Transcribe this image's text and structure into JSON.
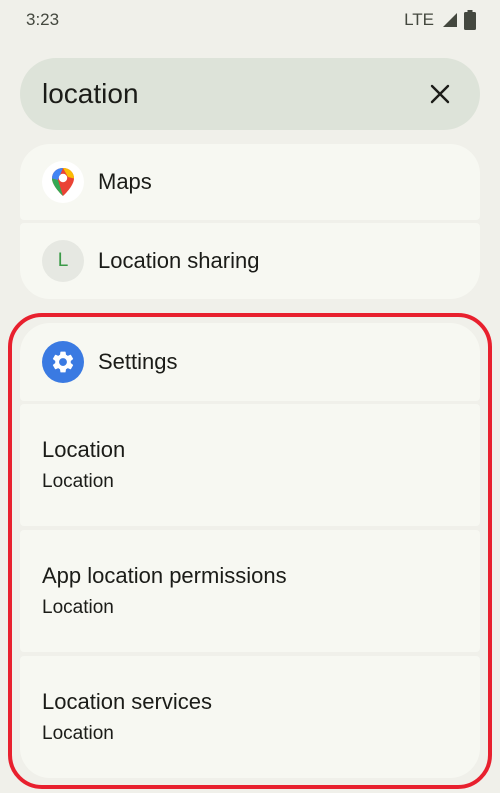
{
  "status_bar": {
    "time": "3:23",
    "network": "LTE"
  },
  "search": {
    "value": "location",
    "clear_icon": "close-icon"
  },
  "app_results": [
    {
      "name": "Maps",
      "icon": "maps-pin-icon"
    },
    {
      "name": "Location sharing",
      "icon_letter": "L"
    }
  ],
  "settings_section": {
    "title": "Settings",
    "icon": "gear-icon",
    "items": [
      {
        "title": "Location",
        "subtitle": "Location"
      },
      {
        "title": "App location permissions",
        "subtitle": "Location"
      },
      {
        "title": "Location services",
        "subtitle": "Location"
      }
    ]
  },
  "colors": {
    "background": "#f0f0ea",
    "search_bar": "#dde3d9",
    "card": "#f7f8f2",
    "settings_accent": "#3a7ae2",
    "highlight": "#e8202e",
    "letter_avatar_text": "#3b9a48"
  }
}
